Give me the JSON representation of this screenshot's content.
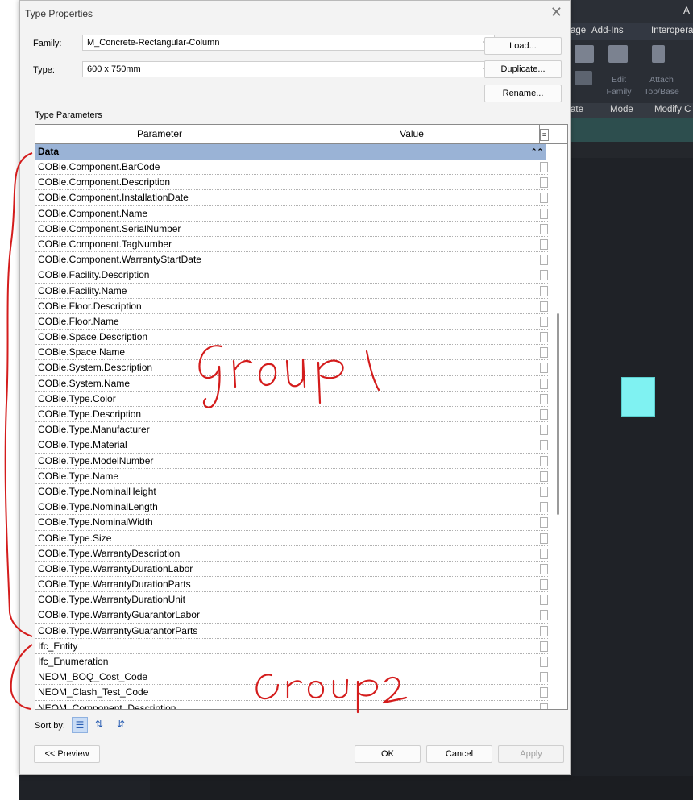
{
  "dialog": {
    "title": "Type Properties",
    "close_glyph": "✕",
    "family_label": "Family:",
    "family_value": "M_Concrete-Rectangular-Column",
    "type_label": "Type:",
    "type_value": "600 x 750mm",
    "load_button": "Load...",
    "duplicate_button": "Duplicate...",
    "rename_button": "Rename...",
    "type_parameters_label": "Type Parameters",
    "columns": {
      "parameter": "Parameter",
      "value": "Value"
    },
    "group_name": "Data",
    "parameters": [
      "COBie.Component.BarCode",
      "COBie.Component.Description",
      "COBie.Component.InstallationDate",
      "COBie.Component.Name",
      "COBie.Component.SerialNumber",
      "COBie.Component.TagNumber",
      "COBie.Component.WarrantyStartDate",
      "COBie.Facility.Description",
      "COBie.Facility.Name",
      "COBie.Floor.Description",
      "COBie.Floor.Name",
      "COBie.Space.Description",
      "COBie.Space.Name",
      "COBie.System.Description",
      "COBie.System.Name",
      "COBie.Type.Color",
      "COBie.Type.Description",
      "COBie.Type.Manufacturer",
      "COBie.Type.Material",
      "COBie.Type.ModelNumber",
      "COBie.Type.Name",
      "COBie.Type.NominalHeight",
      "COBie.Type.NominalLength",
      "COBie.Type.NominalWidth",
      "COBie.Type.Size",
      "COBie.Type.WarrantyDescription",
      "COBie.Type.WarrantyDurationLabor",
      "COBie.Type.WarrantyDurationParts",
      "COBie.Type.WarrantyDurationUnit",
      "COBie.Type.WarrantyGuarantorLabor",
      "COBie.Type.WarrantyGuarantorParts",
      "Ifc_Entity",
      "Ifc_Enumeration",
      "NEOM_BOQ_Cost_Code",
      "NEOM_Clash_Test_Code",
      "NEOM_Component_Description"
    ],
    "sort_label": "Sort by:",
    "preview_button": "<< Preview",
    "ok_button": "OK",
    "cancel_button": "Cancel",
    "apply_button": "Apply"
  },
  "background_app": {
    "title_fragment": "A",
    "ribbon_tabs": [
      "age",
      "Add-Ins",
      "Interopera"
    ],
    "ribbon_buttons": [
      "Edit Family",
      "Attach Top/Base"
    ],
    "panel_labels": [
      "ate",
      "Mode",
      "Modify C"
    ]
  },
  "annotations": {
    "group1_text": "Group1",
    "group2_text": "Group2",
    "ink_color": "#d41c1c"
  }
}
